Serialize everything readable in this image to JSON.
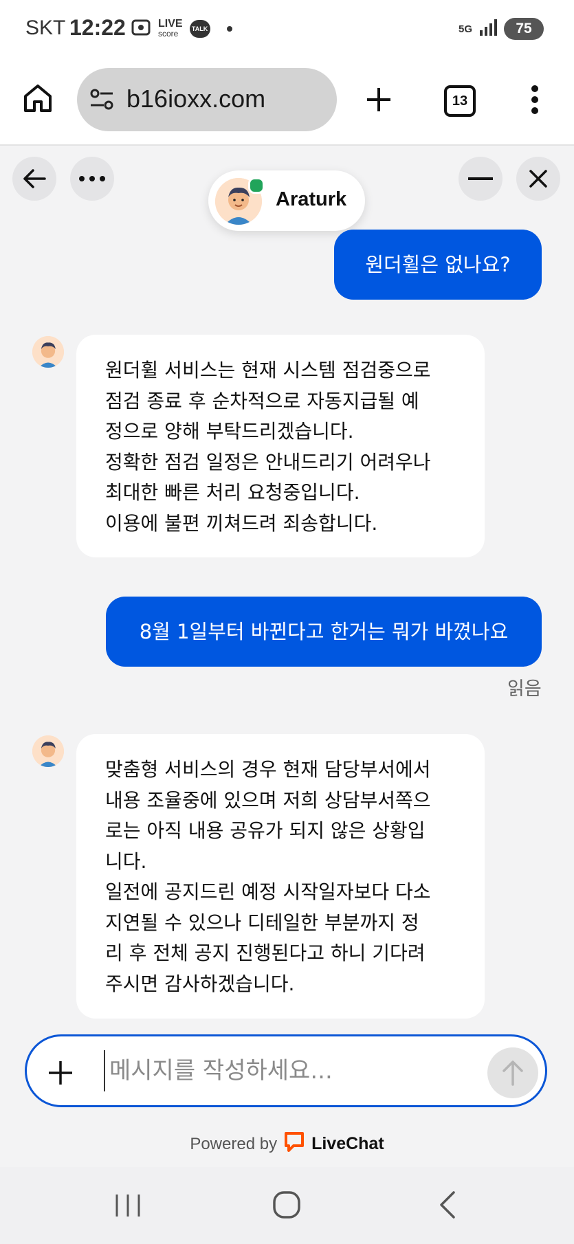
{
  "status": {
    "carrier": "SKT",
    "time": "12:22",
    "live_label": "LIVE",
    "score_label": "score",
    "talk_label": "TALK",
    "network": "5G",
    "battery": "75"
  },
  "browser": {
    "url": "b16ioxx.com",
    "tab_count": "13"
  },
  "chat": {
    "agent_name": "Araturk",
    "agent_status_color": "#21a45a",
    "user_bubble_color": "#0057e0",
    "messages": [
      {
        "from": "user",
        "text": "원더휠은 없나요?"
      },
      {
        "from": "agent",
        "lines": [
          "원더휠 서비스는 현재 시스템 점검중으로",
          "점검 종료 후 순차적으로 자동지급될 예",
          "정으로 양해 부탁드리겠습니다.",
          "정확한 점검 일정은 안내드리기 어려우나",
          "최대한 빠른 처리 요청중입니다.",
          "이용에 불편 끼쳐드려 죄송합니다."
        ]
      },
      {
        "from": "user",
        "text": "8월 1일부터 바뀐다고 한거는 뭐가 바꼈나요"
      },
      {
        "from": "agent",
        "lines": [
          "맞춤형 서비스의 경우 현재 담당부서에서",
          "내용 조율중에 있으며 저희 상담부서쪽으",
          "로는 아직 내용 공유가 되지 않은 상황입",
          "니다.",
          "일전에 공지드린 예정 시작일자보다 다소",
          "지연될 수 있으나 디테일한 부분까지 정",
          "리 후 전체 공지 진행된다고 하니 기다려",
          "주시면 감사하겠습니다."
        ]
      }
    ],
    "read_receipt": "읽음",
    "composer_placeholder": "메시지를 작성하세요...",
    "powered_by": "Powered by",
    "brand": "LiveChat",
    "brand_color": "#ff5100"
  }
}
